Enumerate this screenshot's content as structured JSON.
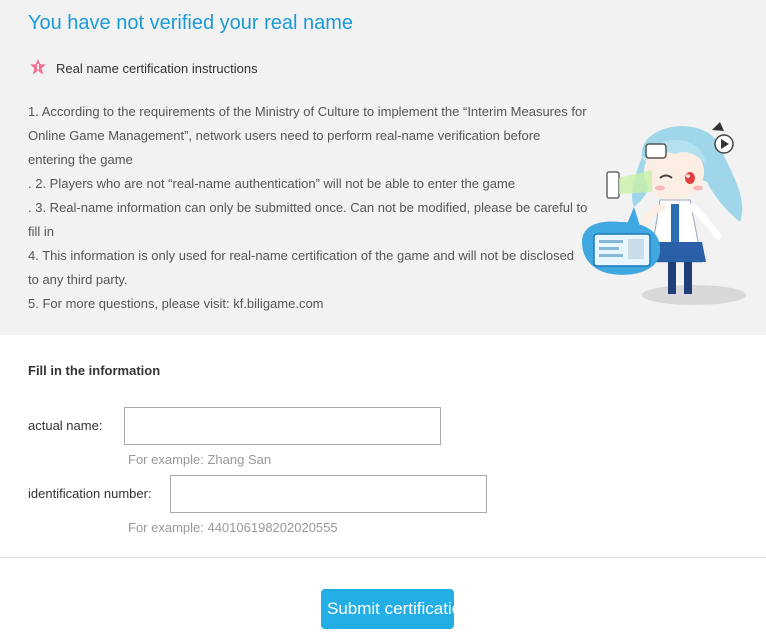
{
  "header": {
    "title": "You have not verified your real name"
  },
  "instructions": {
    "heading": "Real name certification instructions",
    "items": [
      "1. According to the requirements of the Ministry of Culture to implement the “Interim Measures for Online Game Management”, network users need to perform real-name verification before entering the game",
      ". 2. Players who are not “real-name authentication” will not be able to enter the game",
      ". 3. Real-name information can only be submitted once. Can not be modified, please be careful to fill in",
      "4. This information is only used for real-name certification of the game and will not be disclosed to any third party.",
      "5. For more questions, please visit: kf.biligame.com"
    ]
  },
  "form": {
    "title": "Fill in the information",
    "name_label": "actual name:",
    "name_value": "",
    "name_hint": "For example: Zhang San",
    "id_label": "identification number:",
    "id_value": "",
    "id_hint": "For example: 440106198202020555"
  },
  "submit": {
    "label": "Submit certification"
  },
  "icons": {
    "warning": "warning-star-icon",
    "mascot": "mascot-illustration"
  },
  "colors": {
    "accent": "#1c9ad6",
    "button": "#23aee5",
    "warning": "#f07090",
    "panel": "#f2f2f2"
  }
}
